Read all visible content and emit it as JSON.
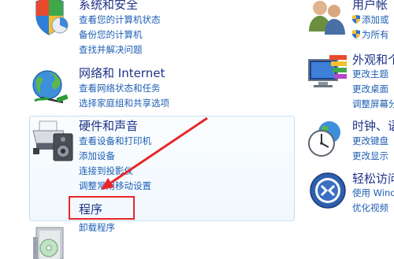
{
  "categories": {
    "system_security": {
      "title": "系统和安全",
      "links": [
        "查看您的计算机状态",
        "备份您的计算机",
        "查找并解决问题"
      ]
    },
    "network": {
      "title": "网络和 Internet",
      "links": [
        "查看网络状态和任务",
        "选择家庭组和共享选项"
      ]
    },
    "hardware_sound": {
      "title": "硬件和声音",
      "links": [
        "查看设备和打印机",
        "添加设备",
        "连接到投影仪",
        "调整常用移动设置"
      ]
    },
    "programs": {
      "title": "程序",
      "links": [
        "卸载程序"
      ]
    },
    "user_accounts": {
      "title": "用户帐",
      "links": [
        "添加或",
        "为所有"
      ]
    },
    "appearance": {
      "title": "外观和个",
      "links": [
        "更改主题",
        "更改桌面",
        "调整屏幕分"
      ]
    },
    "clock": {
      "title": "时钟、语",
      "links": [
        "更改键盘",
        "更改显示"
      ]
    },
    "ease_access": {
      "title": "轻松访问",
      "links": [
        "使用 Wind",
        "优化视频"
      ]
    }
  },
  "colors": {
    "title": "#1e3287",
    "link": "#1e5fb4",
    "highlight": "#e8262a"
  },
  "icons": {
    "system_security": "shield-chart-icon",
    "network": "globe-network-icon",
    "hardware_sound": "printer-speaker-icon",
    "programs": "software-box-icon",
    "user_accounts": "users-icon",
    "appearance": "monitor-palette-icon",
    "clock": "clock-globe-icon",
    "ease_access": "accessibility-icon",
    "uac_shield": "uac-shield-icon"
  }
}
